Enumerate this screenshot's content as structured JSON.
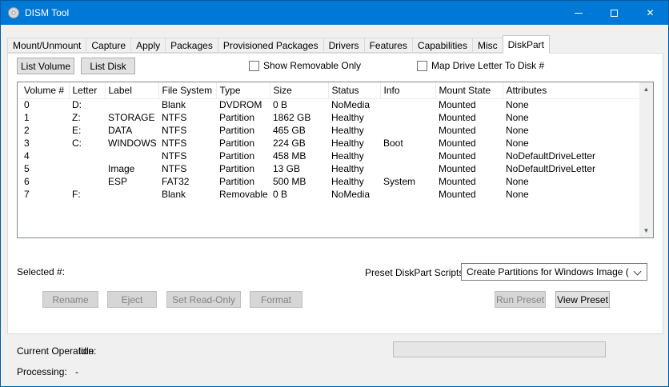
{
  "window": {
    "title": "DISM Tool",
    "titlebar_color": "#0078d7",
    "close_glyph": "✕"
  },
  "icons": {
    "scroll_up": "▲",
    "scroll_down": "▼"
  },
  "tabs": [
    {
      "label": "Mount/Unmount",
      "active": false
    },
    {
      "label": "Capture",
      "active": false
    },
    {
      "label": "Apply",
      "active": false
    },
    {
      "label": "Packages",
      "active": false
    },
    {
      "label": "Provisioned Packages",
      "active": false
    },
    {
      "label": "Drivers",
      "active": false
    },
    {
      "label": "Features",
      "active": false
    },
    {
      "label": "Capabilities",
      "active": false
    },
    {
      "label": "Misc",
      "active": false
    },
    {
      "label": "DiskPart",
      "active": true
    }
  ],
  "toolbar": {
    "list_volume_label": "List Volume",
    "list_disk_label": "List Disk",
    "show_removable_only_label": "Show Removable Only",
    "show_removable_only_checked": false,
    "map_drive_letter_label": "Map Drive Letter To Disk #",
    "map_drive_letter_checked": false
  },
  "volumes_table": {
    "columns": [
      "Volume #",
      "Letter",
      "Label",
      "File System",
      "Type",
      "Size",
      "Status",
      "Info",
      "Mount State",
      "Attributes"
    ],
    "rows": [
      [
        "0",
        "D:",
        "",
        "Blank",
        "DVDROM",
        "0 B",
        "NoMedia",
        "",
        "Mounted",
        "None"
      ],
      [
        "1",
        "Z:",
        "STORAGE",
        "NTFS",
        "Partition",
        "1862 GB",
        "Healthy",
        "",
        "Mounted",
        "None"
      ],
      [
        "2",
        "E:",
        "DATA",
        "NTFS",
        "Partition",
        "465 GB",
        "Healthy",
        "",
        "Mounted",
        "None"
      ],
      [
        "3",
        "C:",
        "WINDOWS",
        "NTFS",
        "Partition",
        "224 GB",
        "Healthy",
        "Boot",
        "Mounted",
        "None"
      ],
      [
        "4",
        "",
        "",
        "NTFS",
        "Partition",
        "458 MB",
        "Healthy",
        "",
        "Mounted",
        "NoDefaultDriveLetter"
      ],
      [
        "5",
        "",
        "Image",
        "NTFS",
        "Partition",
        "13 GB",
        "Healthy",
        "",
        "Mounted",
        "NoDefaultDriveLetter"
      ],
      [
        "6",
        "",
        "ESP",
        "FAT32",
        "Partition",
        "500 MB",
        "Healthy",
        "System",
        "Mounted",
        "None"
      ],
      [
        "7",
        "F:",
        "",
        "Blank",
        "Removable",
        "0 B",
        "NoMedia",
        "",
        "Mounted",
        "None"
      ]
    ]
  },
  "selection": {
    "label": "Selected #:"
  },
  "preset": {
    "label": "Preset DiskPart Scripts",
    "selected_option": "Create Partitions for Windows Image (GPT)"
  },
  "actions": {
    "rename_label": "Rename",
    "eject_label": "Eject",
    "set_read_only_label": "Set Read-Only",
    "format_label": "Format",
    "run_preset_label": "Run Preset",
    "view_preset_label": "View Preset"
  },
  "status": {
    "current_operation_label": "Current Operation:",
    "current_operation_value": "Idle",
    "processing_label": "Processing:",
    "processing_value": "-",
    "progress_percent": 0
  }
}
